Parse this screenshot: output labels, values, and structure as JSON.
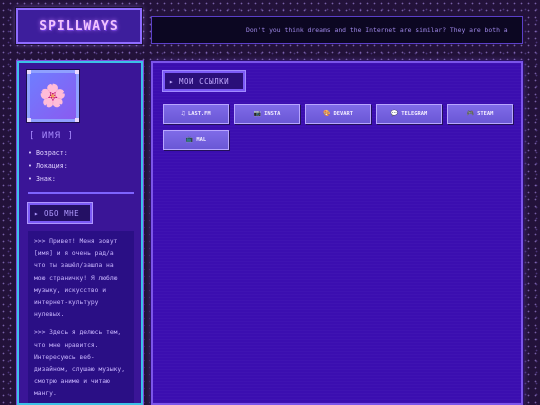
{
  "header": {
    "logo": "SPILLWAYS",
    "ticker": "Don't you think dreams and the Internet are similar? They are both a"
  },
  "sidebar": {
    "avatar_icon": "🌸",
    "name": "[ ИМЯ ]",
    "details": [
      "• Возраст:",
      "• Локация:",
      "• Знак:"
    ],
    "about_button": "▸ ОБО МНЕ",
    "about_paragraphs": [
      ">>> Привет! Меня зовут [имя] и я очень рад/а что ты зашёл/зашла на мою страничку! Я люблю музыку, искусство и интернет-культуру нулевых.",
      ">>> Здесь я делюсь тем, что мне нравится. Интересуюсь веб-дизайном, слушаю музыку, смотрю аниме и читаю мангу."
    ]
  },
  "main": {
    "links_title": "▸ МОИ ССЫЛКИ",
    "links": [
      {
        "icon": "♫",
        "label": "LAST.FM"
      },
      {
        "icon": "📷",
        "label": "INSTA"
      },
      {
        "icon": "🎨",
        "label": "DEVART"
      },
      {
        "icon": "💬",
        "label": "TELEGRAM"
      },
      {
        "icon": "🎮",
        "label": "STEAM"
      },
      {
        "icon": "📺",
        "label": "MAL"
      }
    ]
  },
  "colors": {
    "accent": "#8f6cff",
    "sidebar_border": "#3cc0e6",
    "panel_bg": "#3b0eb0"
  }
}
